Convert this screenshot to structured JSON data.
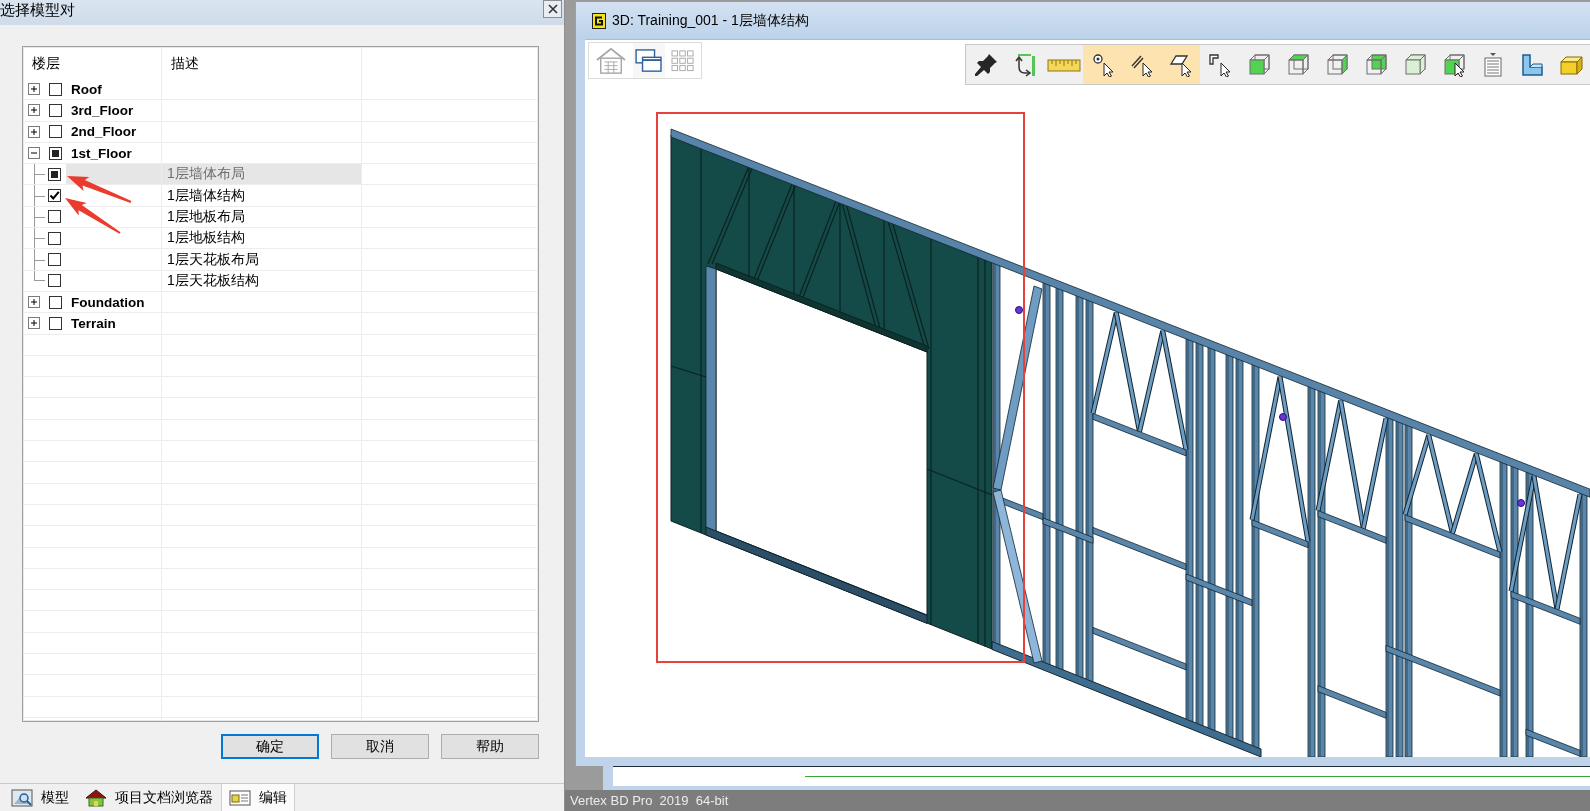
{
  "dialog": {
    "title": "选择模型对",
    "columns": [
      "楼层",
      "描述"
    ],
    "levels": [
      {
        "label": "Roof",
        "expanded": false,
        "checked": false,
        "partial": false,
        "selected": false
      },
      {
        "label": "3rd_Floor",
        "expanded": false,
        "checked": false,
        "partial": false,
        "selected": false
      },
      {
        "label": "2nd_Floor",
        "expanded": false,
        "checked": false,
        "partial": false,
        "selected": false
      },
      {
        "label": "1st_Floor",
        "expanded": true,
        "checked": false,
        "partial": true,
        "selected": false,
        "children": [
          {
            "description": "1层墙体布局",
            "checked": false,
            "partial": true,
            "selected": true
          },
          {
            "description": "1层墙体结构",
            "checked": true,
            "partial": false,
            "selected": false
          },
          {
            "description": "1层地板布局",
            "checked": false,
            "partial": false,
            "selected": false
          },
          {
            "description": "1层地板结构",
            "checked": false,
            "partial": false,
            "selected": false
          },
          {
            "description": "1层天花板布局",
            "checked": false,
            "partial": false,
            "selected": false
          },
          {
            "description": "1层天花板结构",
            "checked": false,
            "partial": false,
            "selected": false
          }
        ]
      },
      {
        "label": "Foundation",
        "expanded": false,
        "checked": false,
        "partial": false,
        "selected": false
      },
      {
        "label": "Terrain",
        "expanded": false,
        "checked": false,
        "partial": false,
        "selected": false
      }
    ],
    "buttons": [
      {
        "label": "确定",
        "focused": true
      },
      {
        "label": "取消",
        "focused": false
      },
      {
        "label": "帮助",
        "focused": false
      }
    ]
  },
  "panel_tabs": [
    {
      "kind": "model",
      "label": "模型",
      "selected": false
    },
    {
      "kind": "browser",
      "label": "项目文档浏览器",
      "selected": false
    },
    {
      "kind": "edit",
      "label": "编辑",
      "selected": true
    }
  ],
  "view_window": {
    "title": "3D: Training_001 - 1层墙体结构",
    "view_buttons": [
      {
        "kind": "house",
        "selected": false
      },
      {
        "kind": "windows",
        "selected": true
      },
      {
        "kind": "grid",
        "selected": false
      }
    ],
    "toolbar": [
      {
        "kind": "pin",
        "selected": false
      },
      {
        "kind": "rotate",
        "selected": false
      },
      {
        "kind": "ruler",
        "selected": false
      },
      {
        "kind": "pick-point",
        "selected": true
      },
      {
        "kind": "pick-edge",
        "selected": true
      },
      {
        "kind": "pick-face",
        "selected": true
      },
      {
        "kind": "pick-corner",
        "selected": false
      },
      {
        "kind": "cube-front",
        "selected": false
      },
      {
        "kind": "cube-top",
        "selected": false
      },
      {
        "kind": "cube-right",
        "selected": false
      },
      {
        "kind": "cube-back",
        "selected": false
      },
      {
        "kind": "cube-shaded",
        "selected": false
      },
      {
        "kind": "cube-cursor",
        "selected": false
      },
      {
        "kind": "list",
        "selected": false
      },
      {
        "kind": "profile",
        "selected": false
      },
      {
        "kind": "box",
        "selected": false
      }
    ]
  },
  "status_bar": {
    "text": "Vertex BD Pro  2019  64-bit"
  }
}
